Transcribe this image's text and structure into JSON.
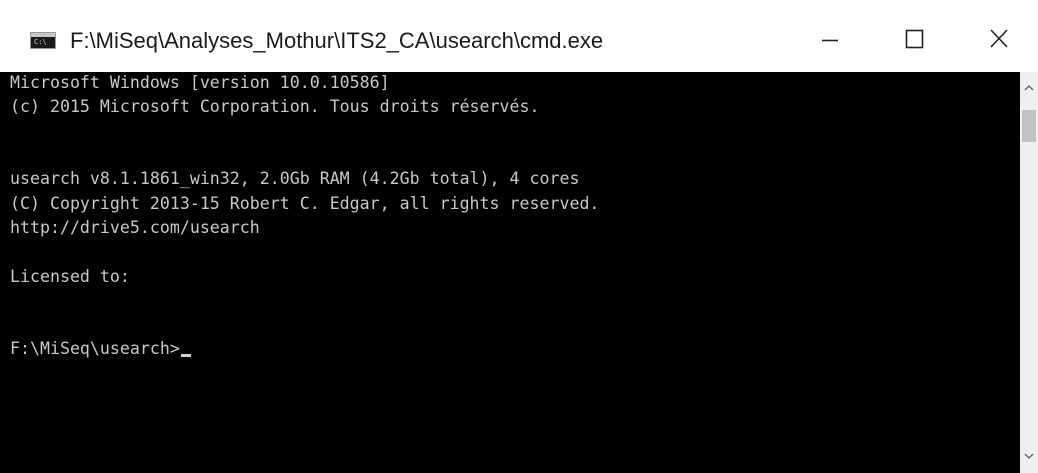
{
  "window": {
    "title": "F:\\MiSeq\\Analyses_Mothur\\ITS2_CA\\usearch\\cmd.exe",
    "app_icon": "cmd-icon",
    "app_icon_text": "C:\\"
  },
  "controls": {
    "minimize": "minimize-icon",
    "maximize": "maximize-icon",
    "close": "close-icon"
  },
  "console": {
    "lines": [
      "Microsoft Windows [version 10.0.10586]",
      "(c) 2015 Microsoft Corporation. Tous droits réservés.",
      "",
      "",
      "usearch v8.1.1861_win32, 2.0Gb RAM (4.2Gb total), 4 cores",
      "(C) Copyright 2013-15 Robert C. Edgar, all rights reserved.",
      "http://drive5.com/usearch",
      "",
      "Licensed to:",
      "",
      "",
      "F:\\MiSeq\\usearch>"
    ],
    "text_color": "#c8c8c8",
    "background": "#000000"
  },
  "scrollbar": {
    "up": "scroll-up-arrow-icon",
    "down": "scroll-down-arrow-icon"
  }
}
